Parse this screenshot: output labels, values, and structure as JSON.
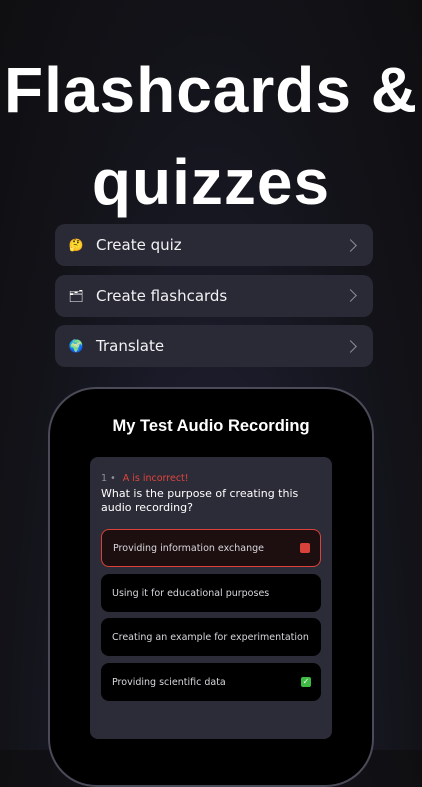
{
  "headline": {
    "line1": "Flashcards &",
    "line2": "quizzes"
  },
  "menu": [
    {
      "label": "Create quiz",
      "icon": "thinking-face-emoji",
      "glyph": "🤔"
    },
    {
      "label": "Create flashcards",
      "icon": "card-index-emoji",
      "glyph": "🗂"
    },
    {
      "label": "Translate",
      "icon": "globe-emoji",
      "glyph": "🌍"
    }
  ],
  "phone": {
    "title": "My Test Audio Recording",
    "quiz": {
      "number": "1",
      "separator": "•",
      "status": "A is incorrect!",
      "question": "What is the purpose of creating this audio recording?",
      "options": [
        {
          "text": "Providing information exchange",
          "state": "incorrect"
        },
        {
          "text": "Using it for educational purposes",
          "state": "none"
        },
        {
          "text": "Creating an example for experimentation",
          "state": "none"
        },
        {
          "text": "Providing scientific data",
          "state": "correct"
        }
      ]
    }
  },
  "colors": {
    "incorrect": "#d8423a",
    "correct": "#3dbb43",
    "card": "#2c2c38"
  }
}
